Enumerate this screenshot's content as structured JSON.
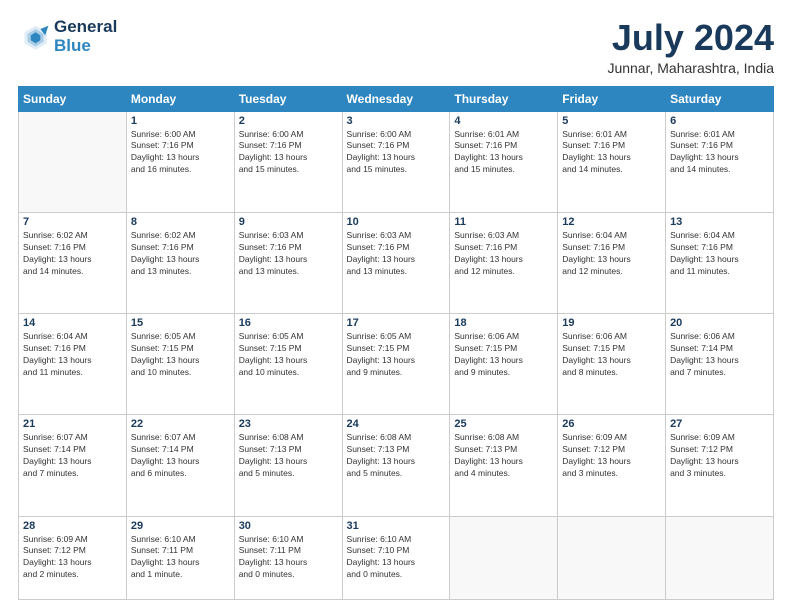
{
  "header": {
    "logo_line1": "General",
    "logo_line2": "Blue",
    "month": "July 2024",
    "location": "Junnar, Maharashtra, India"
  },
  "weekdays": [
    "Sunday",
    "Monday",
    "Tuesday",
    "Wednesday",
    "Thursday",
    "Friday",
    "Saturday"
  ],
  "weeks": [
    [
      {
        "day": "",
        "info": ""
      },
      {
        "day": "1",
        "info": "Sunrise: 6:00 AM\nSunset: 7:16 PM\nDaylight: 13 hours\nand 16 minutes."
      },
      {
        "day": "2",
        "info": "Sunrise: 6:00 AM\nSunset: 7:16 PM\nDaylight: 13 hours\nand 15 minutes."
      },
      {
        "day": "3",
        "info": "Sunrise: 6:00 AM\nSunset: 7:16 PM\nDaylight: 13 hours\nand 15 minutes."
      },
      {
        "day": "4",
        "info": "Sunrise: 6:01 AM\nSunset: 7:16 PM\nDaylight: 13 hours\nand 15 minutes."
      },
      {
        "day": "5",
        "info": "Sunrise: 6:01 AM\nSunset: 7:16 PM\nDaylight: 13 hours\nand 14 minutes."
      },
      {
        "day": "6",
        "info": "Sunrise: 6:01 AM\nSunset: 7:16 PM\nDaylight: 13 hours\nand 14 minutes."
      }
    ],
    [
      {
        "day": "7",
        "info": "Sunrise: 6:02 AM\nSunset: 7:16 PM\nDaylight: 13 hours\nand 14 minutes."
      },
      {
        "day": "8",
        "info": "Sunrise: 6:02 AM\nSunset: 7:16 PM\nDaylight: 13 hours\nand 13 minutes."
      },
      {
        "day": "9",
        "info": "Sunrise: 6:03 AM\nSunset: 7:16 PM\nDaylight: 13 hours\nand 13 minutes."
      },
      {
        "day": "10",
        "info": "Sunrise: 6:03 AM\nSunset: 7:16 PM\nDaylight: 13 hours\nand 13 minutes."
      },
      {
        "day": "11",
        "info": "Sunrise: 6:03 AM\nSunset: 7:16 PM\nDaylight: 13 hours\nand 12 minutes."
      },
      {
        "day": "12",
        "info": "Sunrise: 6:04 AM\nSunset: 7:16 PM\nDaylight: 13 hours\nand 12 minutes."
      },
      {
        "day": "13",
        "info": "Sunrise: 6:04 AM\nSunset: 7:16 PM\nDaylight: 13 hours\nand 11 minutes."
      }
    ],
    [
      {
        "day": "14",
        "info": "Sunrise: 6:04 AM\nSunset: 7:16 PM\nDaylight: 13 hours\nand 11 minutes."
      },
      {
        "day": "15",
        "info": "Sunrise: 6:05 AM\nSunset: 7:15 PM\nDaylight: 13 hours\nand 10 minutes."
      },
      {
        "day": "16",
        "info": "Sunrise: 6:05 AM\nSunset: 7:15 PM\nDaylight: 13 hours\nand 10 minutes."
      },
      {
        "day": "17",
        "info": "Sunrise: 6:05 AM\nSunset: 7:15 PM\nDaylight: 13 hours\nand 9 minutes."
      },
      {
        "day": "18",
        "info": "Sunrise: 6:06 AM\nSunset: 7:15 PM\nDaylight: 13 hours\nand 9 minutes."
      },
      {
        "day": "19",
        "info": "Sunrise: 6:06 AM\nSunset: 7:15 PM\nDaylight: 13 hours\nand 8 minutes."
      },
      {
        "day": "20",
        "info": "Sunrise: 6:06 AM\nSunset: 7:14 PM\nDaylight: 13 hours\nand 7 minutes."
      }
    ],
    [
      {
        "day": "21",
        "info": "Sunrise: 6:07 AM\nSunset: 7:14 PM\nDaylight: 13 hours\nand 7 minutes."
      },
      {
        "day": "22",
        "info": "Sunrise: 6:07 AM\nSunset: 7:14 PM\nDaylight: 13 hours\nand 6 minutes."
      },
      {
        "day": "23",
        "info": "Sunrise: 6:08 AM\nSunset: 7:13 PM\nDaylight: 13 hours\nand 5 minutes."
      },
      {
        "day": "24",
        "info": "Sunrise: 6:08 AM\nSunset: 7:13 PM\nDaylight: 13 hours\nand 5 minutes."
      },
      {
        "day": "25",
        "info": "Sunrise: 6:08 AM\nSunset: 7:13 PM\nDaylight: 13 hours\nand 4 minutes."
      },
      {
        "day": "26",
        "info": "Sunrise: 6:09 AM\nSunset: 7:12 PM\nDaylight: 13 hours\nand 3 minutes."
      },
      {
        "day": "27",
        "info": "Sunrise: 6:09 AM\nSunset: 7:12 PM\nDaylight: 13 hours\nand 3 minutes."
      }
    ],
    [
      {
        "day": "28",
        "info": "Sunrise: 6:09 AM\nSunset: 7:12 PM\nDaylight: 13 hours\nand 2 minutes."
      },
      {
        "day": "29",
        "info": "Sunrise: 6:10 AM\nSunset: 7:11 PM\nDaylight: 13 hours\nand 1 minute."
      },
      {
        "day": "30",
        "info": "Sunrise: 6:10 AM\nSunset: 7:11 PM\nDaylight: 13 hours\nand 0 minutes."
      },
      {
        "day": "31",
        "info": "Sunrise: 6:10 AM\nSunset: 7:10 PM\nDaylight: 13 hours\nand 0 minutes."
      },
      {
        "day": "",
        "info": ""
      },
      {
        "day": "",
        "info": ""
      },
      {
        "day": "",
        "info": ""
      }
    ]
  ]
}
